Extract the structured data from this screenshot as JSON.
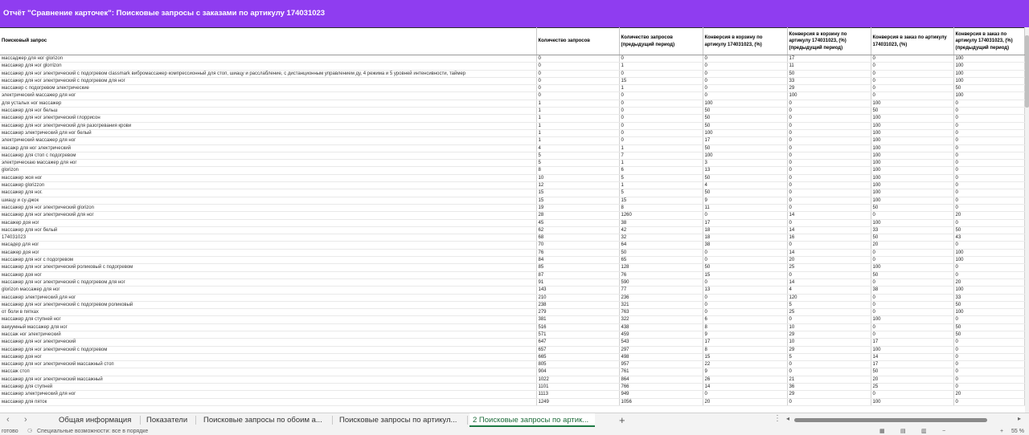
{
  "title": "Отчёт \"Сравнение карточек\": Поисковые запросы с заказами по артикулу 174031023",
  "columns": [
    "Поисковый запрос",
    "Количество запросов",
    "Количество запросов (предыдущий период)",
    "Конверсия в корзину по артикулу 174031023, (%)",
    "Конверсия в корзину по артикулу 174031023, (%) (предыдущий период)",
    "Конверсия в заказ по артикулу 174031023, (%)",
    "Конверсия в заказ по артикулу 174031023, (%) (предыдущий период)"
  ],
  "rows": [
    [
      "массаджер для ног glorizon",
      "0",
      "0",
      "0",
      "17",
      "0",
      "100"
    ],
    [
      "массажер для ног glorrizon",
      "0",
      "1",
      "0",
      "11",
      "0",
      "100"
    ],
    [
      "массажер для ног электрический с подогревом classmark вибромассажер компрессионный для стоп, шиацу и расслабление, с дистанционным управлением ду, 4 режима и 5 уровней интенсивности, таймер",
      "0",
      "0",
      "0",
      "50",
      "0",
      "100"
    ],
    [
      "массажер для ног электрический с подогревом для ног",
      "0",
      "15",
      "0",
      "33",
      "0",
      "100"
    ],
    [
      "массажер с подогревом электрические",
      "0",
      "1",
      "0",
      "29",
      "0",
      "50"
    ],
    [
      "электрический массажер для ног",
      "0",
      "0",
      "0",
      "100",
      "0",
      "100"
    ],
    [
      "для усталых ног массажер",
      "1",
      "0",
      "100",
      "0",
      "100",
      "0"
    ],
    [
      "массажер для ног бельш",
      "1",
      "0",
      "50",
      "0",
      "50",
      "0"
    ],
    [
      "массажер для ног электрический глоррисон",
      "1",
      "0",
      "50",
      "0",
      "100",
      "0"
    ],
    [
      "массажер для ног электрический для разогревания крови",
      "1",
      "0",
      "50",
      "0",
      "100",
      "0"
    ],
    [
      "массажер электрический для ног белый",
      "1",
      "0",
      "100",
      "0",
      "100",
      "0"
    ],
    [
      "электрический массажер для ног",
      "1",
      "0",
      "17",
      "0",
      "100",
      "0"
    ],
    [
      "масажр для ног электрический",
      "4",
      "1",
      "50",
      "0",
      "100",
      "0"
    ],
    [
      "массажер для стоп с подогревом",
      "5",
      "7",
      "100",
      "0",
      "100",
      "0"
    ],
    [
      "электрическаю массажер для ног",
      "5",
      "1",
      "3",
      "0",
      "100",
      "0"
    ],
    [
      "glorizon",
      "8",
      "6",
      "13",
      "0",
      "100",
      "0"
    ],
    [
      "массажер жоя ног",
      "10",
      "5",
      "50",
      "0",
      "100",
      "0"
    ],
    [
      "массажер glorizzon",
      "12",
      "1",
      "4",
      "0",
      "100",
      "0"
    ],
    [
      "массажер для ног.",
      "15",
      "5",
      "50",
      "0",
      "100",
      "0"
    ],
    [
      "шиацу и су-джок",
      "15",
      "15",
      "9",
      "0",
      "100",
      "0"
    ],
    [
      "массажер для ног электрический glorizon",
      "19",
      "8",
      "11",
      "0",
      "50",
      "0"
    ],
    [
      "массажер для ног электрический для ног",
      "28",
      "1260",
      "0",
      "14",
      "0",
      "20"
    ],
    [
      "масажер доя ног",
      "45",
      "38",
      "17",
      "0",
      "100",
      "0"
    ],
    [
      "массажер для ног белый",
      "62",
      "42",
      "18",
      "14",
      "33",
      "50"
    ],
    [
      "174031023",
      "68",
      "32",
      "18",
      "16",
      "50",
      "43"
    ],
    [
      "масадер для ног",
      "70",
      "64",
      "38",
      "0",
      "20",
      "0"
    ],
    [
      "масажер доя ног",
      "76",
      "50",
      "0",
      "14",
      "0",
      "100"
    ],
    [
      "массажер для ног с подогревом",
      "84",
      "65",
      "0",
      "20",
      "0",
      "100"
    ],
    [
      "массажер для ног электрический роликовый с подогревом",
      "85",
      "128",
      "50",
      "25",
      "100",
      "0"
    ],
    [
      "массажер доя ног",
      "87",
      "76",
      "15",
      "0",
      "50",
      "0"
    ],
    [
      "массажер для ног электрический с подогревом для ног",
      "91",
      "590",
      "0",
      "14",
      "0",
      "20"
    ],
    [
      "glorizon массажер для ног",
      "143",
      "77",
      "13",
      "4",
      "38",
      "100"
    ],
    [
      "массажер электрический для ног",
      "210",
      "236",
      "0",
      "120",
      "0",
      "33"
    ],
    [
      "массажер для ног электрический с подогревом роликовый",
      "238",
      "321",
      "0",
      "5",
      "0",
      "50"
    ],
    [
      "от боли в пятках",
      "279",
      "763",
      "0",
      "25",
      "0",
      "100"
    ],
    [
      "массажер для ступней ног",
      "381",
      "322",
      "6",
      "0",
      "100",
      "0"
    ],
    [
      "вакуумный массажер для ног",
      "516",
      "438",
      "8",
      "10",
      "0",
      "50"
    ],
    [
      "массаж ног электрический",
      "571",
      "459",
      "9",
      "29",
      "0",
      "50"
    ],
    [
      "массажер для ног электрический",
      "647",
      "543",
      "17",
      "10",
      "17",
      "0"
    ],
    [
      "массажер для ног электрический с подогревом",
      "657",
      "297",
      "8",
      "29",
      "100",
      "0"
    ],
    [
      "массажер доя ног",
      "665",
      "498",
      "15",
      "5",
      "14",
      "0"
    ],
    [
      "массажер для ног электрический массажный стоп",
      "805",
      "957",
      "22",
      "0",
      "17",
      "0"
    ],
    [
      "массаж стоп",
      "904",
      "761",
      "9",
      "0",
      "50",
      "0"
    ],
    [
      "массажер для ног электрический массажный",
      "1022",
      "864",
      "26",
      "21",
      "20",
      "0"
    ],
    [
      "массажер для ступней",
      "1101",
      "766",
      "14",
      "36",
      "25",
      "0"
    ],
    [
      "массажер электрический для ног",
      "1113",
      "949",
      "0",
      "29",
      "0",
      "20"
    ],
    [
      "массажер для пяток",
      "1249",
      "1056",
      "20",
      "0",
      "100",
      "0"
    ]
  ],
  "sheet_tabs": [
    "Общая информация",
    "Показатели",
    "Поисковые запросы по обоим а...",
    "Поисковые запросы по артикул...",
    "2 Поисковые запросы по артик..."
  ],
  "active_tab_index": 4,
  "add_tab_symbol": "+",
  "status": {
    "left": "готово",
    "message": "Специальные возможности: все в порядке",
    "zoom": "55 %"
  }
}
